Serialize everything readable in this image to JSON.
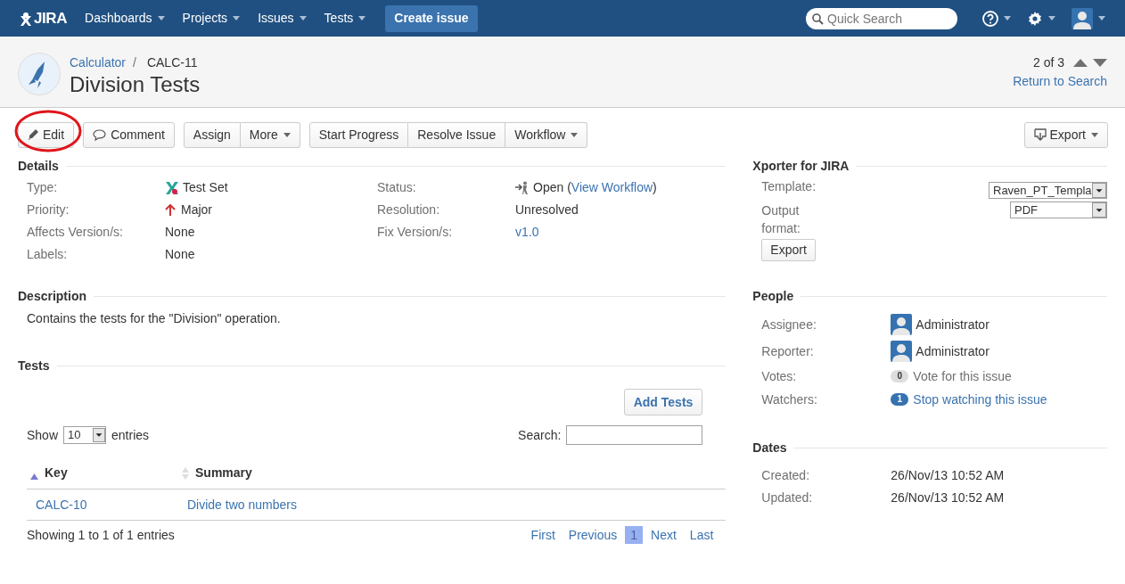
{
  "nav": {
    "logo": "JIRA",
    "menus": [
      {
        "label": "Dashboards"
      },
      {
        "label": "Projects"
      },
      {
        "label": "Issues"
      },
      {
        "label": "Tests"
      }
    ],
    "create": "Create issue",
    "search": {
      "placeholder": "Quick Search"
    }
  },
  "header": {
    "project": "Calculator",
    "separator": "/",
    "key": "CALC-11",
    "title": "Division Tests",
    "pager": "2 of 3",
    "return": "Return to Search"
  },
  "toolbar": {
    "groups": [
      [
        {
          "label": "Edit",
          "kind": "edit",
          "dropdown": false,
          "highlighted": true
        }
      ],
      [
        {
          "label": "Comment",
          "kind": "comment",
          "dropdown": false,
          "highlighted": false
        }
      ],
      [
        {
          "label": "Assign",
          "kind": "plain",
          "dropdown": false,
          "highlighted": false
        },
        {
          "label": "More",
          "kind": "plain",
          "dropdown": true,
          "highlighted": false
        }
      ],
      [
        {
          "label": "Start Progress",
          "kind": "plain",
          "dropdown": false,
          "highlighted": false
        },
        {
          "label": "Resolve Issue",
          "kind": "plain",
          "dropdown": false,
          "highlighted": false
        },
        {
          "label": "Workflow",
          "kind": "plain",
          "dropdown": true,
          "highlighted": false
        }
      ]
    ],
    "export": {
      "label": "Export",
      "dropdown": true
    }
  },
  "details": {
    "title": "Details",
    "fields": [
      {
        "label": "Type:",
        "kind": "type",
        "parts": [
          {
            "text": "Test Set",
            "link": false
          }
        ]
      },
      {
        "label": "Status:",
        "kind": "status",
        "parts": [
          {
            "text": "Open (",
            "link": false
          },
          {
            "text": "View Workflow",
            "link": true
          },
          {
            "text": ")",
            "link": false
          }
        ]
      },
      {
        "label": "Priority:",
        "kind": "priority",
        "parts": [
          {
            "text": "Major",
            "link": false
          }
        ]
      },
      {
        "label": "Resolution:",
        "kind": "plain",
        "parts": [
          {
            "text": "Unresolved",
            "link": false
          }
        ]
      },
      {
        "label": "Affects Version/s:",
        "kind": "plain",
        "parts": [
          {
            "text": "None",
            "link": false
          }
        ]
      },
      {
        "label": "Fix Version/s:",
        "kind": "plain",
        "parts": [
          {
            "text": "v1.0",
            "link": true
          }
        ]
      },
      {
        "label": "Labels:",
        "kind": "plain",
        "parts": [
          {
            "text": "None",
            "link": false
          }
        ]
      }
    ]
  },
  "description": {
    "title": "Description",
    "text": "Contains the tests for the \"Division\" operation."
  },
  "tests": {
    "title": "Tests",
    "add_button": "Add Tests",
    "show_label": "Show",
    "page_size": "10",
    "entries_label": "entries",
    "search_label": "Search:",
    "columns": [
      {
        "label": "Key",
        "sorted": true
      },
      {
        "label": "Summary",
        "sorted": false
      }
    ],
    "rows": [
      [
        "CALC-10",
        "Divide two numbers"
      ]
    ],
    "info": "Showing 1 to 1 of 1 entries",
    "pagination": [
      {
        "label": "First",
        "selected": false
      },
      {
        "label": "Previous",
        "selected": false
      },
      {
        "label": "1",
        "selected": true
      },
      {
        "label": "Next",
        "selected": false
      },
      {
        "label": "Last",
        "selected": false
      }
    ]
  },
  "xporter": {
    "title": "Xporter for JIRA",
    "template_label": "Template:",
    "template_value": "Raven_PT_Templa",
    "format_label": "Output format:",
    "format_value": "PDF",
    "button": "Export"
  },
  "people": {
    "title": "People",
    "fields": [
      {
        "label": "Assignee:",
        "kind": "user",
        "value": "Administrator"
      },
      {
        "label": "Reporter:",
        "kind": "user",
        "value": "Administrator"
      },
      {
        "label": "Votes:",
        "kind": "count",
        "count": "0",
        "active": false,
        "value": "Vote for this issue"
      },
      {
        "label": "Watchers:",
        "kind": "count",
        "count": "1",
        "active": true,
        "value": "Stop watching this issue"
      }
    ]
  },
  "dates": {
    "title": "Dates",
    "fields": [
      {
        "label": "Created:",
        "value": "26/Nov/13 10:52 AM"
      },
      {
        "label": "Updated:",
        "value": "26/Nov/13 10:52 AM"
      }
    ]
  }
}
